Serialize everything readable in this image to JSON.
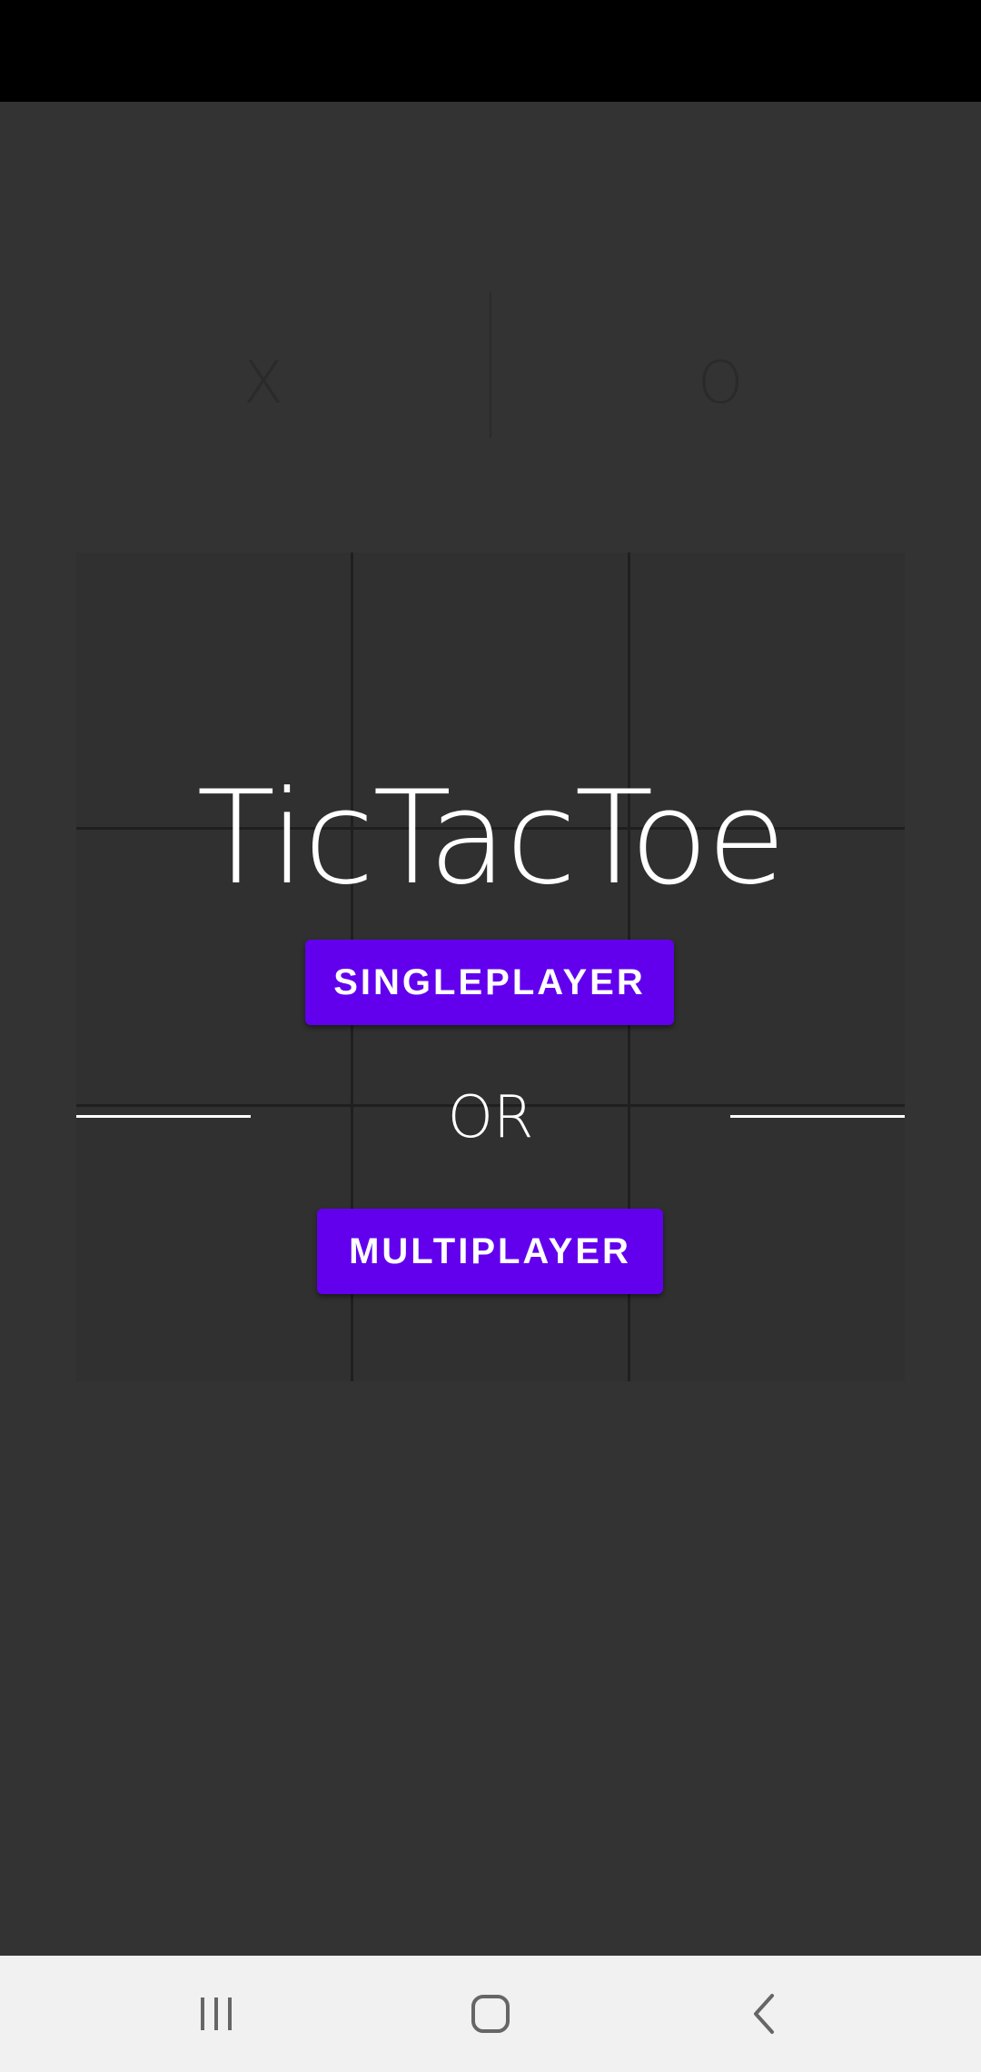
{
  "app": {
    "title": "TicTacToe"
  },
  "score": {
    "player_x": "X",
    "player_o": "O"
  },
  "menu": {
    "singleplayer_label": "SINGLEPLAYER",
    "or_label": "OR",
    "multiplayer_label": "MULTIPLAYER"
  },
  "navigation": {
    "recent_icon": "recent-apps-icon",
    "home_icon": "home-icon",
    "back_icon": "back-icon"
  },
  "colors": {
    "accent": "#6200ee",
    "background": "#333333",
    "status_bar": "#000000",
    "nav_bar": "#f1f1f1"
  }
}
